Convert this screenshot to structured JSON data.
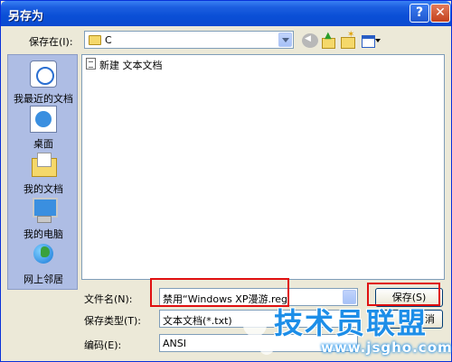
{
  "window": {
    "title": "另存为",
    "help_button": "?",
    "close_button": "✕"
  },
  "location": {
    "label": "保存在(I):",
    "value": "C"
  },
  "places": [
    {
      "label": "我最近的文档",
      "icon": "recent-docs-icon"
    },
    {
      "label": "桌面",
      "icon": "desktop-icon"
    },
    {
      "label": "我的文档",
      "icon": "my-documents-icon"
    },
    {
      "label": "我的电脑",
      "icon": "my-computer-icon"
    },
    {
      "label": "网上邻居",
      "icon": "network-places-icon"
    }
  ],
  "files": [
    {
      "name": "新建 文本文档",
      "icon": "text-document-icon"
    }
  ],
  "filename": {
    "label": "文件名(N):",
    "value": "禁用“Windows XP漫游.reg"
  },
  "filetype": {
    "label": "保存类型(T):",
    "value": "文本文档(*.txt)"
  },
  "encoding": {
    "label": "编码(E):",
    "value": "ANSI"
  },
  "buttons": {
    "save": "保存(S)",
    "cancel_partial": "消"
  },
  "watermark": {
    "brand": "技术员联盟",
    "url": "www.jsgho.com"
  },
  "colors": {
    "title_bar": "#0a4fd6",
    "places_bar": "#aebde4",
    "highlight": "#e01010",
    "watermark": "#1d8ee8"
  }
}
